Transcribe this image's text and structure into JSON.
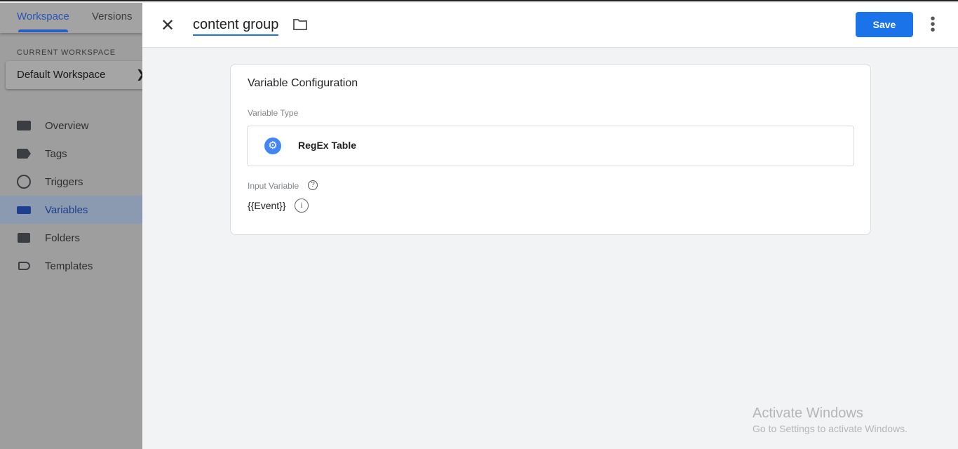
{
  "sidebar": {
    "tabs": [
      {
        "label": "Workspace",
        "active": true
      },
      {
        "label": "Versions",
        "active": false
      }
    ],
    "current_workspace_label": "CURRENT WORKSPACE",
    "workspace_name": "Default Workspace",
    "items": [
      {
        "label": "Overview",
        "icon": "overview-icon"
      },
      {
        "label": "Tags",
        "icon": "tag-icon"
      },
      {
        "label": "Triggers",
        "icon": "trigger-icon"
      },
      {
        "label": "Variables",
        "icon": "variables-icon",
        "selected": true
      },
      {
        "label": "Folders",
        "icon": "folder-icon"
      },
      {
        "label": "Templates",
        "icon": "template-icon"
      }
    ]
  },
  "header": {
    "title": "content group",
    "save_label": "Save"
  },
  "card": {
    "title": "Variable Configuration",
    "variable_type_label": "Variable Type",
    "variable_type": "RegEx Table",
    "input_variable_label": "Input Variable",
    "input_variable_value": "{{Event}}"
  },
  "watermark": {
    "line1": "Activate Windows",
    "line2": "Go to Settings to activate Windows."
  },
  "colors": {
    "accent": "#1a73e8",
    "gear": "#4285f4"
  }
}
